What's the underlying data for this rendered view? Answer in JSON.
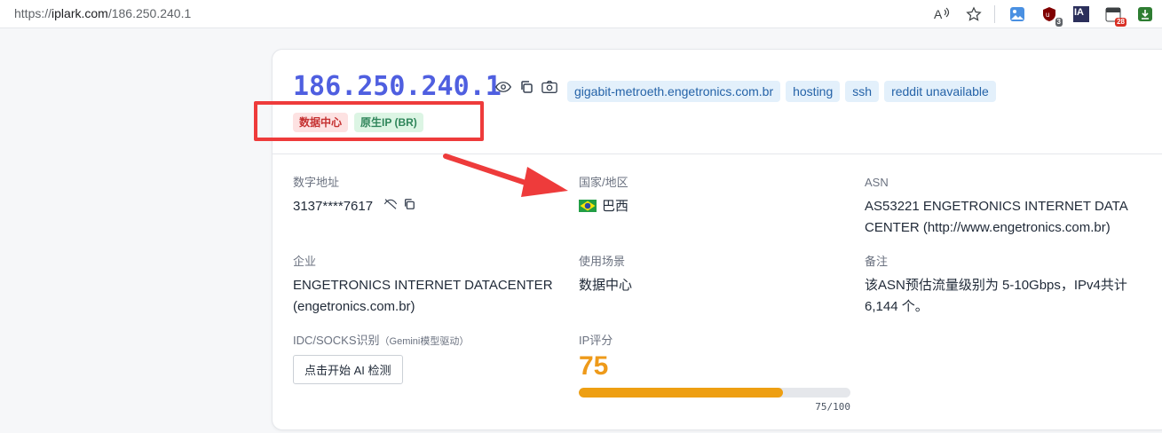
{
  "browser": {
    "url_scheme": "https://",
    "url_host": "iplark.com",
    "url_path": "/186.250.240.1",
    "ext_badges": {
      "ublock": "3",
      "calendar": "28",
      "ia": "IA"
    }
  },
  "header": {
    "ip": "186.250.240.1",
    "tags": [
      "gigabit-metroeth.engetronics.com.br",
      "hosting",
      "ssh",
      "reddit unavailable"
    ],
    "badges": [
      "数据中心",
      "原生IP (BR)"
    ]
  },
  "fields": {
    "digital_address": {
      "label": "数字地址",
      "value": "3137****7617"
    },
    "country": {
      "label": "国家/地区",
      "value": "巴西"
    },
    "asn": {
      "label": "ASN",
      "value_line1": "AS53221 ENGETRONICS INTERNET DATA",
      "value_line2": "CENTER (http://www.engetronics.com.br)"
    },
    "company": {
      "label": "企业",
      "value_line1": "ENGETRONICS INTERNET DATACENTER",
      "value_line2": "(engetronics.com.br)"
    },
    "usage": {
      "label": "使用场景",
      "value": "数据中心"
    },
    "note": {
      "label": "备注",
      "value_line1": "该ASN预估流量级别为 5-10Gbps，IPv4共计",
      "value_line2": "6,144 个。"
    },
    "idc": {
      "label": "IDC/SOCKS识别",
      "label_small": "（Gemini模型驱动）",
      "button": "点击开始 AI 检测"
    },
    "ip_score": {
      "label": "IP评分",
      "score": "75",
      "progress_value": 75,
      "progress_max": 100,
      "progress_text": "75/100"
    }
  },
  "colors": {
    "ip_title": "#4f5fe0",
    "score": "#ee9a1a",
    "annotation": "#ee3b3b"
  }
}
